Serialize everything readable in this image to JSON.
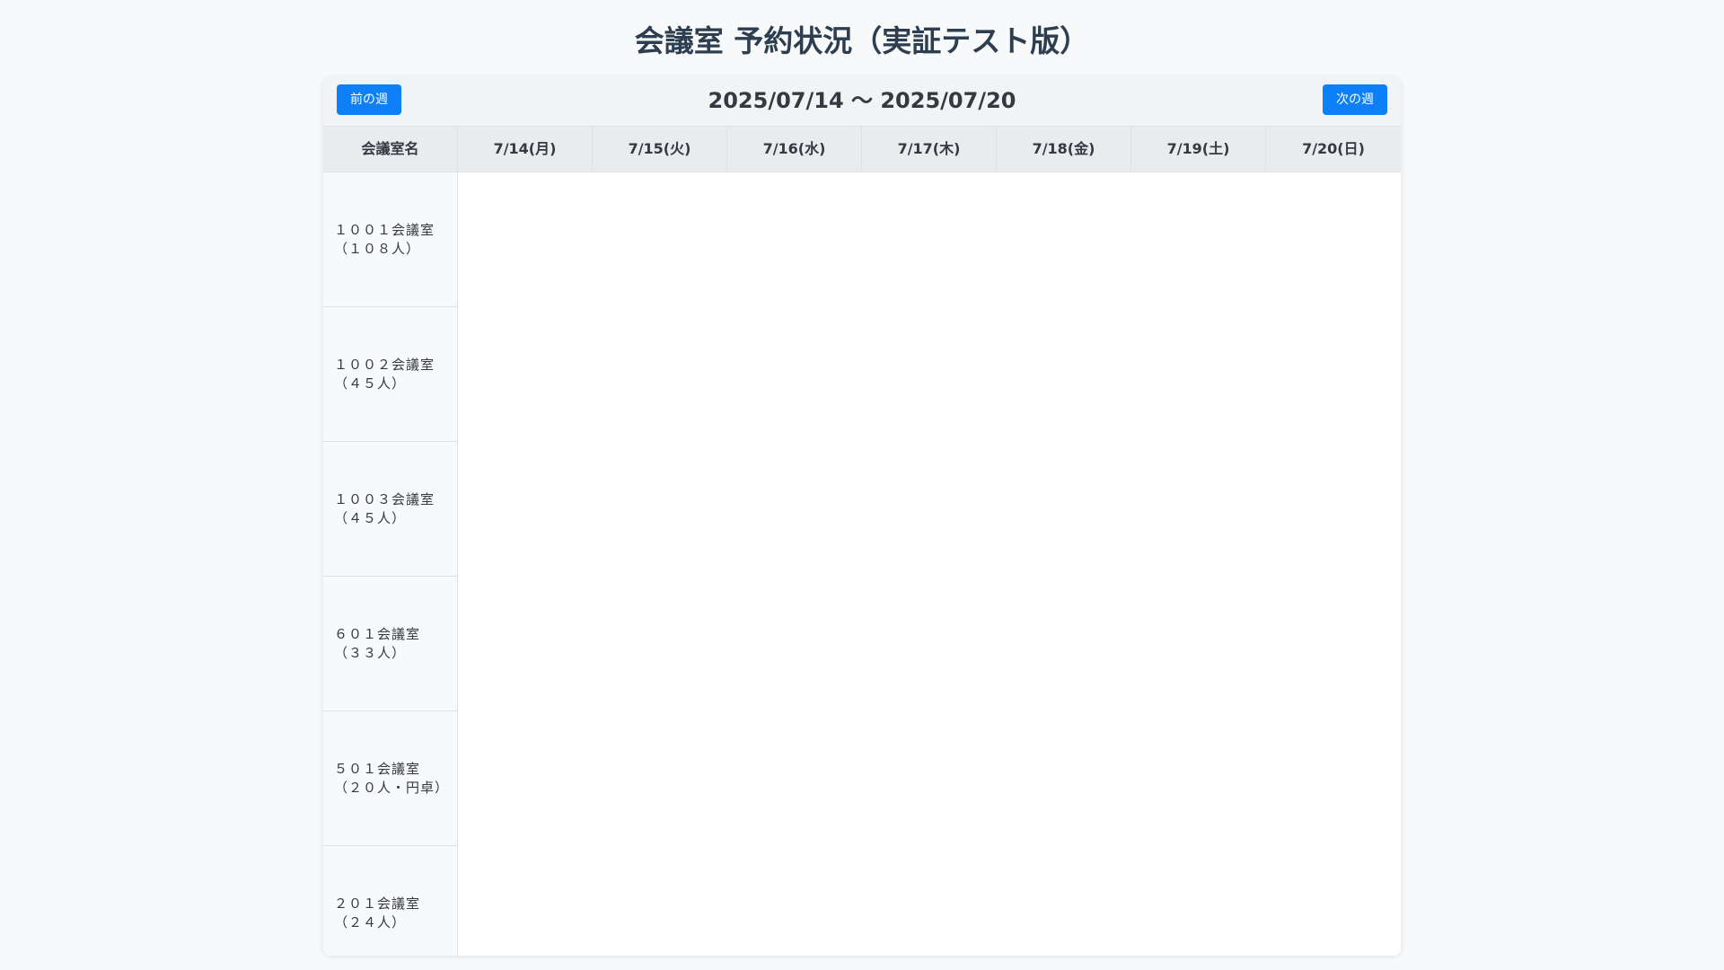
{
  "page": {
    "title": "会議室 予約状況（実証テスト版）"
  },
  "nav": {
    "prev_label": "前の週",
    "next_label": "次の週",
    "week_range": "2025/07/14 ～ 2025/07/20"
  },
  "table": {
    "room_header": "会議室名",
    "days": [
      "7/14(月)",
      "7/15(火)",
      "7/16(水)",
      "7/17(木)",
      "7/18(金)",
      "7/19(土)",
      "7/20(日)"
    ],
    "rooms": [
      "１００１会議室\n（１０８人）",
      "１００２会議室\n（４５人）",
      "１００３会議室\n（４５人）",
      "６０１会議室\n（３３人）",
      "５０１会議室\n（２０人・円卓）",
      "２０１会議室\n（２４人）"
    ]
  },
  "colors": {
    "accent": "#0d7ff7",
    "title": "#2c3e50",
    "header_bg": "#e9ecef",
    "page_bg": "#f7f9fa"
  }
}
